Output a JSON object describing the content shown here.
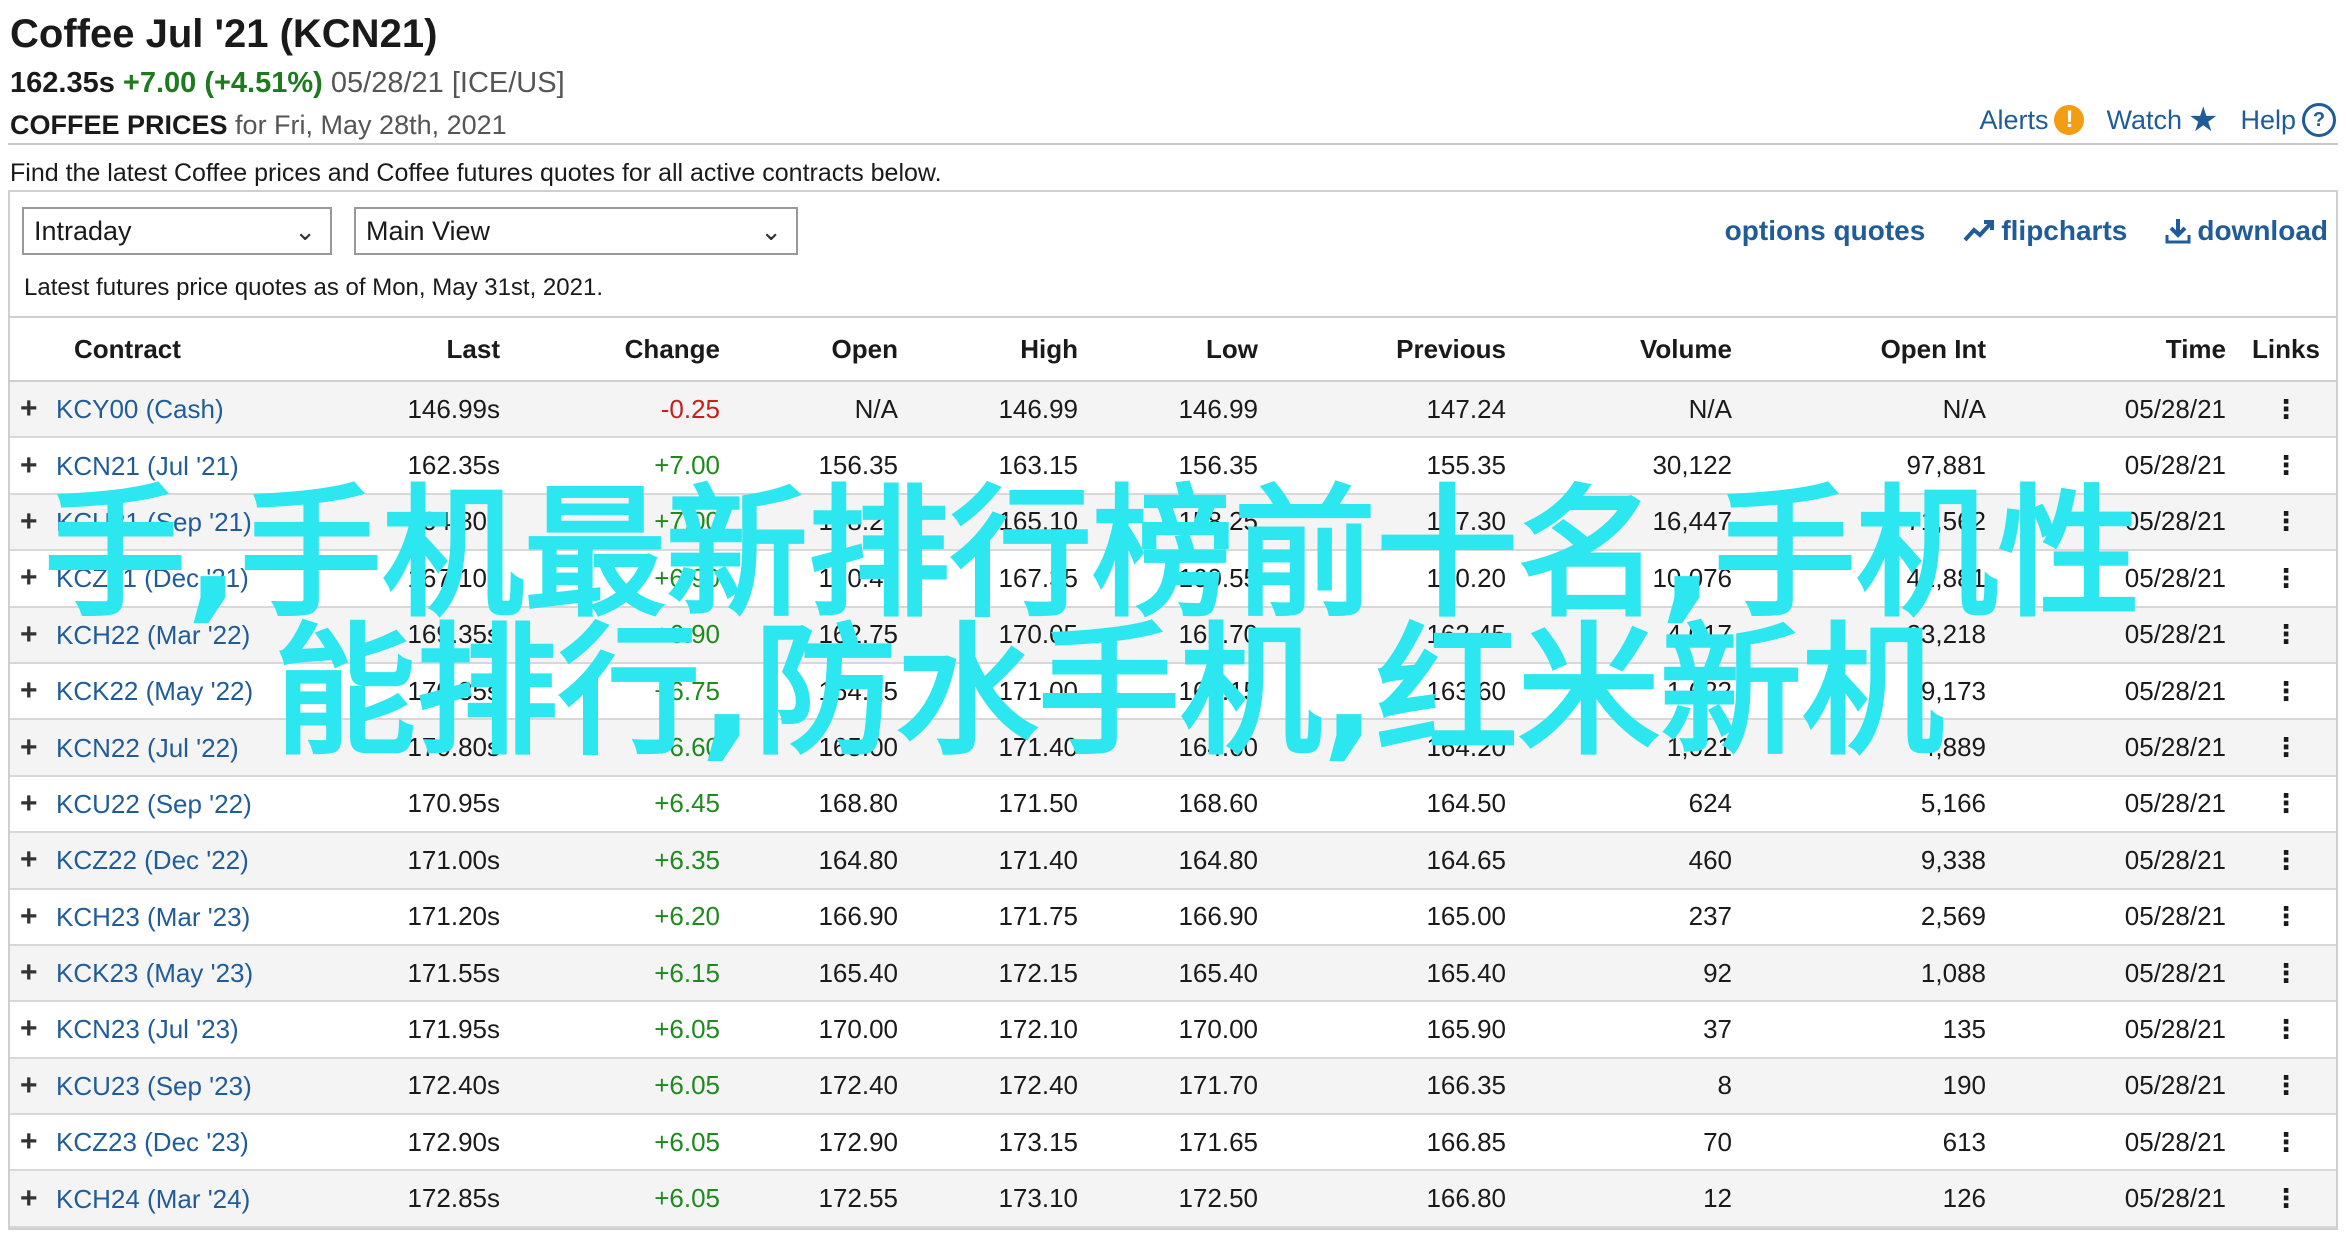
{
  "header": {
    "title": "Coffee Jul '21 (KCN21)",
    "last": "162.35s",
    "change": "+7.00 (+4.51%)",
    "date": "05/28/21",
    "exchange": "[ICE/US]",
    "prices_label": "COFFEE PRICES",
    "prices_for": "for Fri, May 28th, 2021"
  },
  "top_links": {
    "alerts": "Alerts",
    "watch": "Watch",
    "help": "Help"
  },
  "description": "Find the latest Coffee prices and Coffee futures quotes for all active contracts below.",
  "controls": {
    "period": "Intraday",
    "view": "Main View",
    "options_quotes": "options quotes",
    "flipcharts": "flipcharts",
    "download": "download"
  },
  "as_of": "Latest futures price quotes as of Mon, May 31st, 2021.",
  "table": {
    "headers": [
      "Contract",
      "Last",
      "Change",
      "Open",
      "High",
      "Low",
      "Previous",
      "Volume",
      "Open Int",
      "Time",
      "Links"
    ],
    "rows": [
      {
        "contract": "KCY00 (Cash)",
        "last": "146.99s",
        "change": "-0.25",
        "dir": "neg",
        "open": "N/A",
        "high": "146.99",
        "low": "146.99",
        "previous": "147.24",
        "volume": "N/A",
        "open_int": "N/A",
        "time": "05/28/21"
      },
      {
        "contract": "KCN21 (Jul '21)",
        "last": "162.35s",
        "change": "+7.00",
        "dir": "pos",
        "open": "156.35",
        "high": "163.15",
        "low": "156.35",
        "previous": "155.35",
        "volume": "30,122",
        "open_int": "97,881",
        "time": "05/28/21"
      },
      {
        "contract": "KCU21 (Sep '21)",
        "last": "164.80s",
        "change": "+7.00",
        "dir": "pos",
        "open": "158.20",
        "high": "165.10",
        "low": "158.25",
        "previous": "157.30",
        "volume": "16,447",
        "open_int": "71,562",
        "time": "05/28/21"
      },
      {
        "contract": "KCZ21 (Dec '21)",
        "last": "167.10s",
        "change": "+6.90",
        "dir": "pos",
        "open": "160.40",
        "high": "167.35",
        "low": "160.55",
        "previous": "160.20",
        "volume": "10,076",
        "open_int": "42,881",
        "time": "05/28/21"
      },
      {
        "contract": "KCH22 (Mar '22)",
        "last": "169.35s",
        "change": "+6.90",
        "dir": "pos",
        "open": "162.75",
        "high": "170.05",
        "low": "162.70",
        "previous": "162.45",
        "volume": "4,017",
        "open_int": "23,218",
        "time": "05/28/21"
      },
      {
        "contract": "KCK22 (May '22)",
        "last": "170.35s",
        "change": "+6.75",
        "dir": "pos",
        "open": "164.15",
        "high": "171.00",
        "low": "164.15",
        "previous": "163.60",
        "volume": "1,622",
        "open_int": "9,173",
        "time": "05/28/21"
      },
      {
        "contract": "KCN22 (Jul '22)",
        "last": "170.80s",
        "change": "+6.60",
        "dir": "pos",
        "open": "165.00",
        "high": "171.40",
        "low": "164.60",
        "previous": "164.20",
        "volume": "1,021",
        "open_int": "4,889",
        "time": "05/28/21"
      },
      {
        "contract": "KCU22 (Sep '22)",
        "last": "170.95s",
        "change": "+6.45",
        "dir": "pos",
        "open": "168.80",
        "high": "171.50",
        "low": "168.60",
        "previous": "164.50",
        "volume": "624",
        "open_int": "5,166",
        "time": "05/28/21"
      },
      {
        "contract": "KCZ22 (Dec '22)",
        "last": "171.00s",
        "change": "+6.35",
        "dir": "pos",
        "open": "164.80",
        "high": "171.40",
        "low": "164.80",
        "previous": "164.65",
        "volume": "460",
        "open_int": "9,338",
        "time": "05/28/21"
      },
      {
        "contract": "KCH23 (Mar '23)",
        "last": "171.20s",
        "change": "+6.20",
        "dir": "pos",
        "open": "166.90",
        "high": "171.75",
        "low": "166.90",
        "previous": "165.00",
        "volume": "237",
        "open_int": "2,569",
        "time": "05/28/21"
      },
      {
        "contract": "KCK23 (May '23)",
        "last": "171.55s",
        "change": "+6.15",
        "dir": "pos",
        "open": "165.40",
        "high": "172.15",
        "low": "165.40",
        "previous": "165.40",
        "volume": "92",
        "open_int": "1,088",
        "time": "05/28/21"
      },
      {
        "contract": "KCN23 (Jul '23)",
        "last": "171.95s",
        "change": "+6.05",
        "dir": "pos",
        "open": "170.00",
        "high": "172.10",
        "low": "170.00",
        "previous": "165.90",
        "volume": "37",
        "open_int": "135",
        "time": "05/28/21"
      },
      {
        "contract": "KCU23 (Sep '23)",
        "last": "172.40s",
        "change": "+6.05",
        "dir": "pos",
        "open": "172.40",
        "high": "172.40",
        "low": "171.70",
        "previous": "166.35",
        "volume": "8",
        "open_int": "190",
        "time": "05/28/21"
      },
      {
        "contract": "KCZ23 (Dec '23)",
        "last": "172.90s",
        "change": "+6.05",
        "dir": "pos",
        "open": "172.90",
        "high": "173.15",
        "low": "171.65",
        "previous": "166.85",
        "volume": "70",
        "open_int": "613",
        "time": "05/28/21"
      },
      {
        "contract": "KCH24 (Mar '24)",
        "last": "172.85s",
        "change": "+6.05",
        "dir": "pos",
        "open": "172.55",
        "high": "173.10",
        "low": "172.50",
        "previous": "166.80",
        "volume": "12",
        "open_int": "126",
        "time": "05/28/21"
      }
    ]
  },
  "watermark": {
    "line1": "手,手机最新排行榜前十名,手机性",
    "line2": "能排行,防水手机,红米新机"
  },
  "colors": {
    "link": "#1f5c99",
    "positive": "#1e8a1e",
    "negative": "#c81e1e",
    "watermark": "#2ce6f0",
    "alert": "#f29d12"
  },
  "icons": {
    "row_expand": "plus-icon",
    "row_links": "vertical-dots-icon",
    "alerts": "alert-icon",
    "watch": "star-icon",
    "help": "question-icon",
    "select": "chevron-down-icon",
    "flipcharts": "trend-icon",
    "download": "download-icon"
  }
}
